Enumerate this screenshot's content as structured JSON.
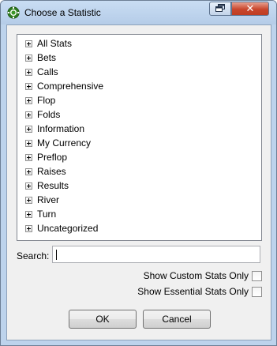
{
  "window": {
    "title": "Choose a Statistic",
    "close_glyph": "✕",
    "app_icon": "poker-chip-icon",
    "restore_icon": "restore-icon"
  },
  "tree": {
    "items": [
      {
        "label": "All Stats"
      },
      {
        "label": "Bets"
      },
      {
        "label": "Calls"
      },
      {
        "label": "Comprehensive"
      },
      {
        "label": "Flop"
      },
      {
        "label": "Folds"
      },
      {
        "label": "Information"
      },
      {
        "label": "My Currency"
      },
      {
        "label": "Preflop"
      },
      {
        "label": "Raises"
      },
      {
        "label": "Results"
      },
      {
        "label": "River"
      },
      {
        "label": "Turn"
      },
      {
        "label": "Uncategorized"
      }
    ]
  },
  "search": {
    "label": "Search:",
    "value": ""
  },
  "options": {
    "custom_only_label": "Show Custom Stats Only",
    "custom_only_checked": false,
    "essential_only_label": "Show Essential Stats Only",
    "essential_only_checked": false
  },
  "buttons": {
    "ok_label": "OK",
    "cancel_label": "Cancel"
  }
}
